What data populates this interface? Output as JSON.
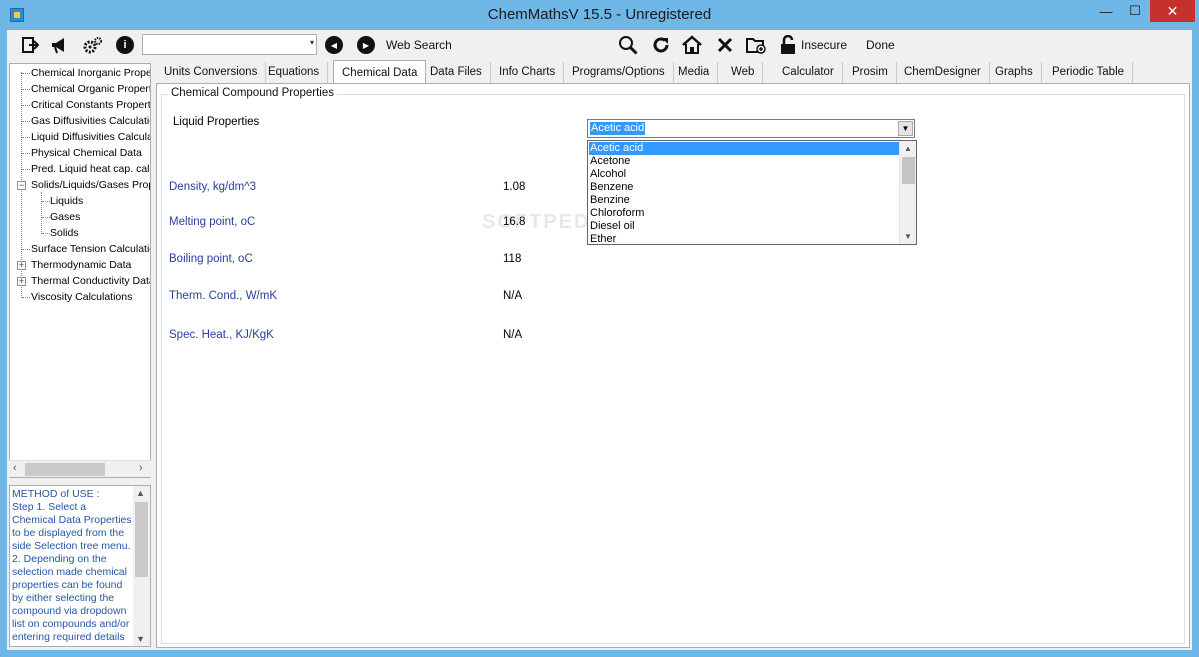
{
  "window": {
    "title": "ChemMathsV 15.5 - Unregistered",
    "min_glyph": "—",
    "max_glyph": "☐",
    "close_glyph": "✕"
  },
  "toolbar": {
    "url_value": "",
    "url_arrow": "▾",
    "back_glyph": "◀",
    "forward_glyph": "▶",
    "web_search_label": "Web Search",
    "insecure_label": "Insecure",
    "done_label": "Done",
    "icons": {
      "exit": "exit-icon",
      "announce": "megaphone-icon",
      "settings": "gears-icon",
      "info": "info-icon",
      "search": "magnifier-icon",
      "refresh": "refresh-icon",
      "home": "home-icon",
      "stop": "close-icon",
      "new_folder": "folder-add-icon",
      "lock": "unlock-icon"
    }
  },
  "tree": {
    "items": [
      {
        "label": "Chemical Inorganic Prope"
      },
      {
        "label": "Chemical Organic Propert"
      },
      {
        "label": "Critical Constants Propert"
      },
      {
        "label": "Gas Diffusivities Calculatio"
      },
      {
        "label": "Liquid Diffusivities Calcula"
      },
      {
        "label": "Physical Chemical Data"
      },
      {
        "label": "Pred. Liquid heat cap. cal"
      },
      {
        "label": "Solids/Liquids/Gases Prop"
      },
      {
        "label": "Liquids"
      },
      {
        "label": "Gases"
      },
      {
        "label": "Solids"
      },
      {
        "label": "Surface Tension Calculatio"
      },
      {
        "label": "Thermodynamic Data"
      },
      {
        "label": "Thermal Conductivity Data"
      },
      {
        "label": "Viscosity Calculations"
      }
    ],
    "collapse_glyph": "−",
    "expand_glyph": "+"
  },
  "help": {
    "lines": [
      "METHOD of USE :",
      "Step 1. Select a",
      "Chemical Data Properties",
      "to be displayed from the",
      "side Selection tree menu.",
      "2. Depending on the",
      "selection made chemical",
      "properties can be found",
      "by either selecting the",
      "compound via dropdown",
      "list on compounds and/or",
      "entering required details"
    ]
  },
  "tabs": [
    {
      "label": "Units Conversions"
    },
    {
      "label": "Equations"
    },
    {
      "label": "Chemical Data"
    },
    {
      "label": "Data Files"
    },
    {
      "label": "Info Charts"
    },
    {
      "label": "Programs/Options"
    },
    {
      "label": "Media"
    },
    {
      "label": "Web"
    },
    {
      "label": "Calculator"
    },
    {
      "label": "Prosim"
    },
    {
      "label": "ChemDesigner"
    },
    {
      "label": "Graphs"
    },
    {
      "label": "Periodic Table"
    }
  ],
  "panel": {
    "group_title": "Chemical Compound Properties",
    "category_label": "Liquid Properties",
    "selected_compound": "Acetic acid",
    "compound_options": [
      "Acetic acid",
      "Acetone",
      "Alcohol",
      "Benzene",
      "Benzine",
      "Chloroform",
      "Diesel oil",
      "Ether"
    ],
    "properties": [
      {
        "label": "Density, kg/dm^3",
        "value": "1.08"
      },
      {
        "label": "Melting point, oC",
        "value": "16.8"
      },
      {
        "label": "Boiling point, oC",
        "value": "118"
      },
      {
        "label": "Therm. Cond., W/mK",
        "value": "N/A"
      },
      {
        "label": "Spec. Heat., KJ/KgK",
        "value": "N/A"
      }
    ],
    "watermark": "SOFTPEDIA"
  },
  "glyphs": {
    "left": "‹",
    "right": "›",
    "up": "▲",
    "down": "▼",
    "combo_down": "▼"
  }
}
